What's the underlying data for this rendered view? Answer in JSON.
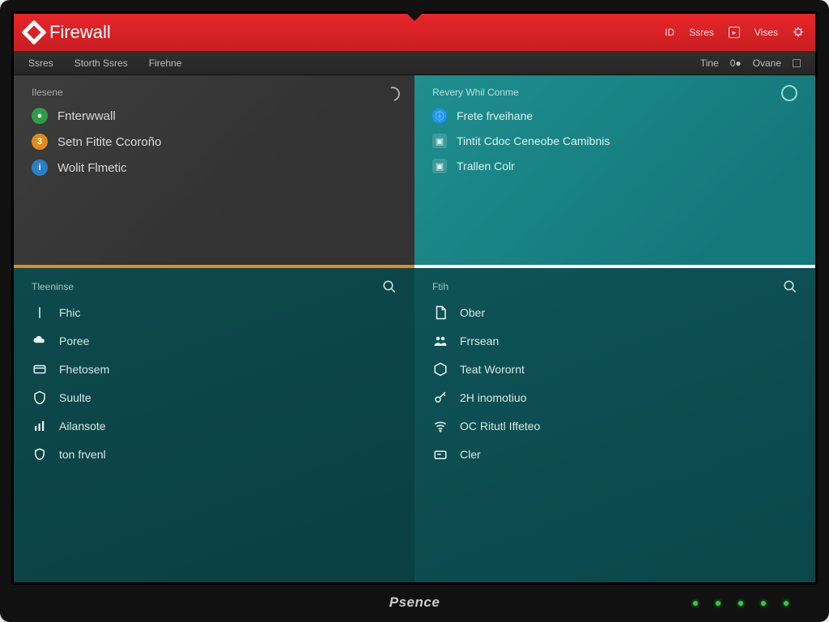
{
  "brand_label": "Psence",
  "titlebar": {
    "title": "Firewall",
    "right": [
      {
        "label": "ID"
      },
      {
        "label": "Ssres"
      },
      {
        "label": "Vises"
      }
    ]
  },
  "menubar": {
    "left": [
      "Ssres",
      "Storth Ssres",
      "Firehne"
    ],
    "right": [
      "Tine",
      "0●",
      "Ovane"
    ]
  },
  "upper_left": {
    "header": "Ilesene",
    "rows": [
      {
        "badge_color": "b-green",
        "label": "Fnterwwall"
      },
      {
        "badge_color": "b-orange",
        "label": "Setn Fitite Ccoroño"
      },
      {
        "badge_color": "b-blue",
        "label": "Wolit Flmetic"
      }
    ]
  },
  "upper_right": {
    "header": "Revery Whil Conme",
    "circle_label": "O",
    "rows": [
      {
        "icon": "blue",
        "label": "Frete frveihane"
      },
      {
        "icon": "box",
        "label": "Tintit Cdoc Ceneobe Camibnis"
      },
      {
        "icon": "box",
        "label": "Trallen Colr"
      }
    ]
  },
  "lower_left": {
    "header": "Tleeninse",
    "items": [
      {
        "icon": "tower",
        "label": "Fhic"
      },
      {
        "icon": "cloud",
        "label": "Poree"
      },
      {
        "icon": "card",
        "label": "Fhetosem"
      },
      {
        "icon": "shield",
        "label": "Suulte"
      },
      {
        "icon": "bars",
        "label": "Ailansote"
      },
      {
        "icon": "shieldo",
        "label": "ton frvenl"
      }
    ]
  },
  "lower_right": {
    "header": "Ftih",
    "items": [
      {
        "icon": "doc",
        "label": "Ober"
      },
      {
        "icon": "people",
        "label": "Frrsean"
      },
      {
        "icon": "hex",
        "label": "Teat Worornt"
      },
      {
        "icon": "key",
        "label": "2H inomotiuo"
      },
      {
        "icon": "wifi",
        "label": "OC Ritutl Iffeteo"
      },
      {
        "icon": "card2",
        "label": "Cler"
      }
    ]
  }
}
